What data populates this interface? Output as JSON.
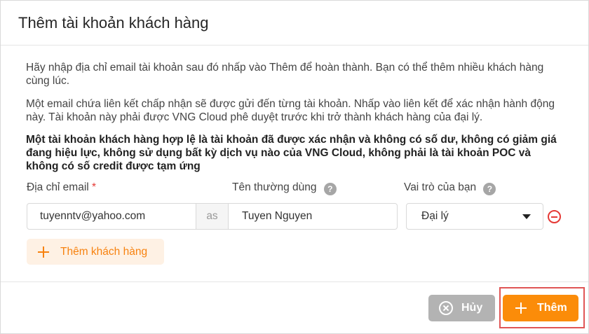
{
  "dialog": {
    "title": "Thêm tài khoản khách hàng"
  },
  "body": {
    "paragraph1": "Hãy nhập địa chỉ email tài khoản sau đó nhấp vào Thêm để hoàn thành. Bạn có thể thêm nhiều khách hàng cùng lúc.",
    "paragraph2": "Một email chứa liên kết chấp nhận sẽ được gửi đến từng tài khoản. Nhấp vào liên kết để xác nhận hành động này. Tài khoản này phải được VNG Cloud phê duyệt trước khi trở thành khách hàng của đại lý.",
    "paragraph3": "Một tài khoản khách hàng hợp lệ là tài khoản đã được xác nhận và không có số dư, không có giảm giá đang hiệu lực, không sử dụng bất kỳ dịch vụ nào của VNG Cloud, không phải là tài khoản POC và không có số credit được tạm ứng"
  },
  "form": {
    "email_label": "Địa chỉ email",
    "required_mark": "*",
    "username_label": "Tên thường dùng",
    "role_label": "Vai trò của bạn",
    "help_glyph": "?",
    "email_value": "tuyenntv@yahoo.com",
    "as_text": "as",
    "username_value": "Tuyen Nguyen",
    "role_value": "Đại lý"
  },
  "actions": {
    "add_customer_label": "Thêm khách hàng",
    "cancel_label": "Hủy",
    "add_label": "Thêm"
  },
  "colors": {
    "accent": "#fb8c09",
    "danger": "#e53935",
    "disabled": "#b3b3b3"
  }
}
